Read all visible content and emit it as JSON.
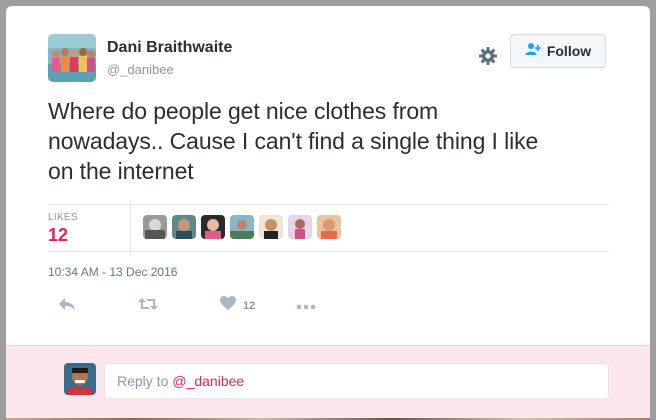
{
  "tweet": {
    "display_name": "Dani Braithwaite",
    "screen_name": "@_danibee",
    "text_lines": [
      "Where do people get nice clothes from",
      "nowadays.. Cause I can't find a single thing I like",
      "on the internet"
    ],
    "timestamp": "10:34 AM - 13 Dec 2016"
  },
  "header": {
    "follow_label": "Follow",
    "settings_icon": "gear-icon",
    "follow_icon": "add-user-icon"
  },
  "stats": {
    "likes_label": "LIKES",
    "likes_count": "12",
    "liker_count_shown": 7
  },
  "actions": {
    "reply_icon": "reply-icon",
    "retweet_icon": "retweet-icon",
    "like_icon": "heart-icon",
    "like_count": "12",
    "more_icon": "more-icon"
  },
  "reply": {
    "prefix": "Reply to",
    "mention": "@_danibee"
  },
  "colors": {
    "accent": "#e0245e",
    "text": "#292f33",
    "muted": "#8899a6",
    "reply_bar": "#fce7ec"
  }
}
